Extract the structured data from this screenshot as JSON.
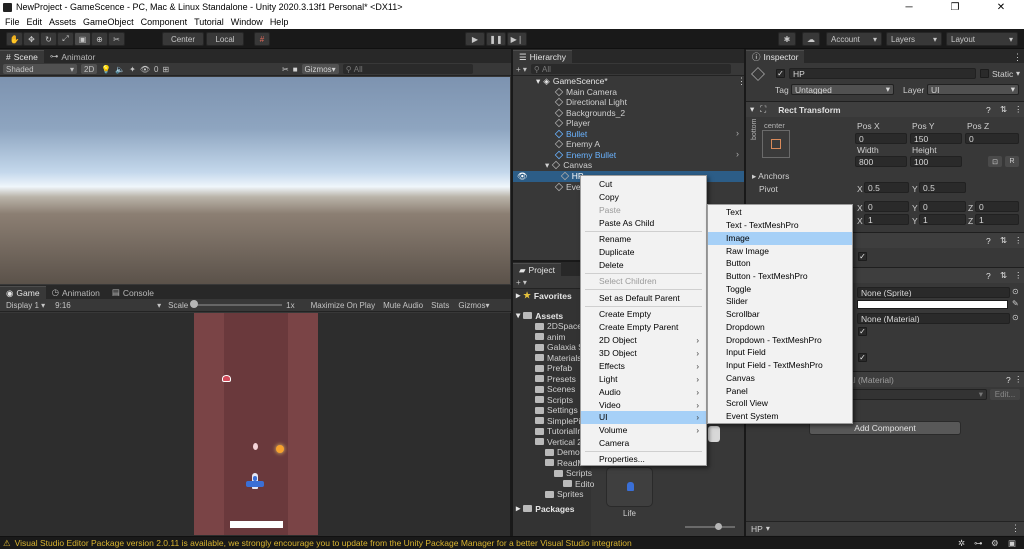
{
  "window": {
    "title": "NewProject - GameScence - PC, Mac & Linux Standalone - Unity 2020.3.13f1 Personal* <DX11>",
    "minimize": "─",
    "maximize": "❐",
    "close": "✕"
  },
  "menu": [
    "File",
    "Edit",
    "Assets",
    "GameObject",
    "Component",
    "Tutorial",
    "Window",
    "Help"
  ],
  "toolbar": {
    "pivot_label": "Center",
    "space_label": "Local",
    "account_label": "Account",
    "layers_label": "Layers",
    "layout_label": "Layout",
    "chevron": "▾"
  },
  "scene_panel": {
    "tabs": [
      "Scene",
      "Animator"
    ],
    "shading": "Shaded",
    "mode_2d": "2D",
    "fx_count": "0",
    "gizmos": "Gizmos",
    "search_placeholder": "All"
  },
  "game_panel": {
    "tabs": [
      "Game",
      "Animation",
      "Console"
    ],
    "display": "Display 1",
    "aspect": "9:16",
    "scale_label": "Scale",
    "scale_value": "1x",
    "maximize": "Maximize On Play",
    "mute": "Mute Audio",
    "stats": "Stats",
    "gizmos": "Gizmos"
  },
  "hierarchy": {
    "tab": "Hierarchy",
    "search_placeholder": "All",
    "scene": "GameScence*",
    "items": [
      {
        "label": "Main Camera",
        "blue": false
      },
      {
        "label": "Directional Light",
        "blue": false
      },
      {
        "label": "Backgrounds_2",
        "blue": false
      },
      {
        "label": "Player",
        "blue": false
      },
      {
        "label": "Bullet",
        "blue": true
      },
      {
        "label": "Enemy A",
        "blue": false
      },
      {
        "label": "Enemy Bullet",
        "blue": true
      },
      {
        "label": "Canvas",
        "blue": false
      },
      {
        "label": "HP",
        "blue": false
      },
      {
        "label": "Even",
        "blue": false
      }
    ]
  },
  "project": {
    "tab": "Project",
    "favorites": "Favorites",
    "assets": "Assets",
    "packages": "Packages",
    "folders": [
      "2DSpace",
      "anim",
      "Galaxia S",
      "Materials",
      "Prefab",
      "Presets",
      "Scenes",
      "Scripts",
      "Settings",
      "SimplePi",
      "TutorialIn",
      "Vertical 2",
      "Demo",
      "ReadMe",
      "Scripts",
      "Edito",
      "Sprites"
    ],
    "grid_item": "Life"
  },
  "inspector": {
    "tab": "Inspector",
    "object_name": "HP",
    "static_label": "Static",
    "tag_label": "Tag",
    "tag_value": "Untagged",
    "layer_label": "Layer",
    "layer_value": "UI",
    "rect_transform": "Rect Transform",
    "anchor_preset": "center",
    "anchor_side": "bottom",
    "pos_x_label": "Pos X",
    "pos_y_label": "Pos Y",
    "pos_z_label": "Pos Z",
    "pos_x": "0",
    "pos_y": "150",
    "pos_z": "0",
    "width_label": "Width",
    "height_label": "Height",
    "width": "800",
    "height": "100",
    "anchors": "Anchors",
    "pivot": "Pivot",
    "pivot_x": "0.5",
    "pivot_y": "0.5",
    "rot_x": "0",
    "rot_y": "0",
    "rot_z": "0",
    "scale_x": "1",
    "scale_y": "1",
    "scale_z": "1",
    "source_image": "None (Sprite)",
    "material": "None (Material)",
    "material_header": "al (Material)",
    "edit_label": "Edit...",
    "add_component": "Add Component",
    "footer_label": "HP",
    "x": "X",
    "y": "Y",
    "z": "Z",
    "r_button": "R",
    "check": "✓"
  },
  "context_menu": {
    "items": [
      "Cut",
      "Copy",
      "Paste",
      "Paste As Child",
      "Rename",
      "Duplicate",
      "Delete",
      "Select Children",
      "Set as Default Parent",
      "Create Empty",
      "Create Empty Parent",
      "2D Object",
      "3D Object",
      "Effects",
      "Light",
      "Audio",
      "Video",
      "UI",
      "Volume",
      "Camera",
      "Properties..."
    ]
  },
  "ui_submenu": {
    "items": [
      "Text",
      "Text - TextMeshPro",
      "Image",
      "Raw Image",
      "Button",
      "Button - TextMeshPro",
      "Toggle",
      "Slider",
      "Scrollbar",
      "Dropdown",
      "Dropdown - TextMeshPro",
      "Input Field",
      "Input Field - TextMeshPro",
      "Canvas",
      "Panel",
      "Scroll View",
      "Event System"
    ]
  },
  "status": {
    "message": "Visual Studio Editor Package version 2.0.11 is available, we strongly encourage you to update from the Unity Package Manager for a better Visual Studio integration"
  },
  "colors": {
    "selection": "#2c5d87",
    "menu_highlight": "#a6d0f7",
    "prefab_blue": "#6ab3ff",
    "warning": "#d9b42f"
  }
}
